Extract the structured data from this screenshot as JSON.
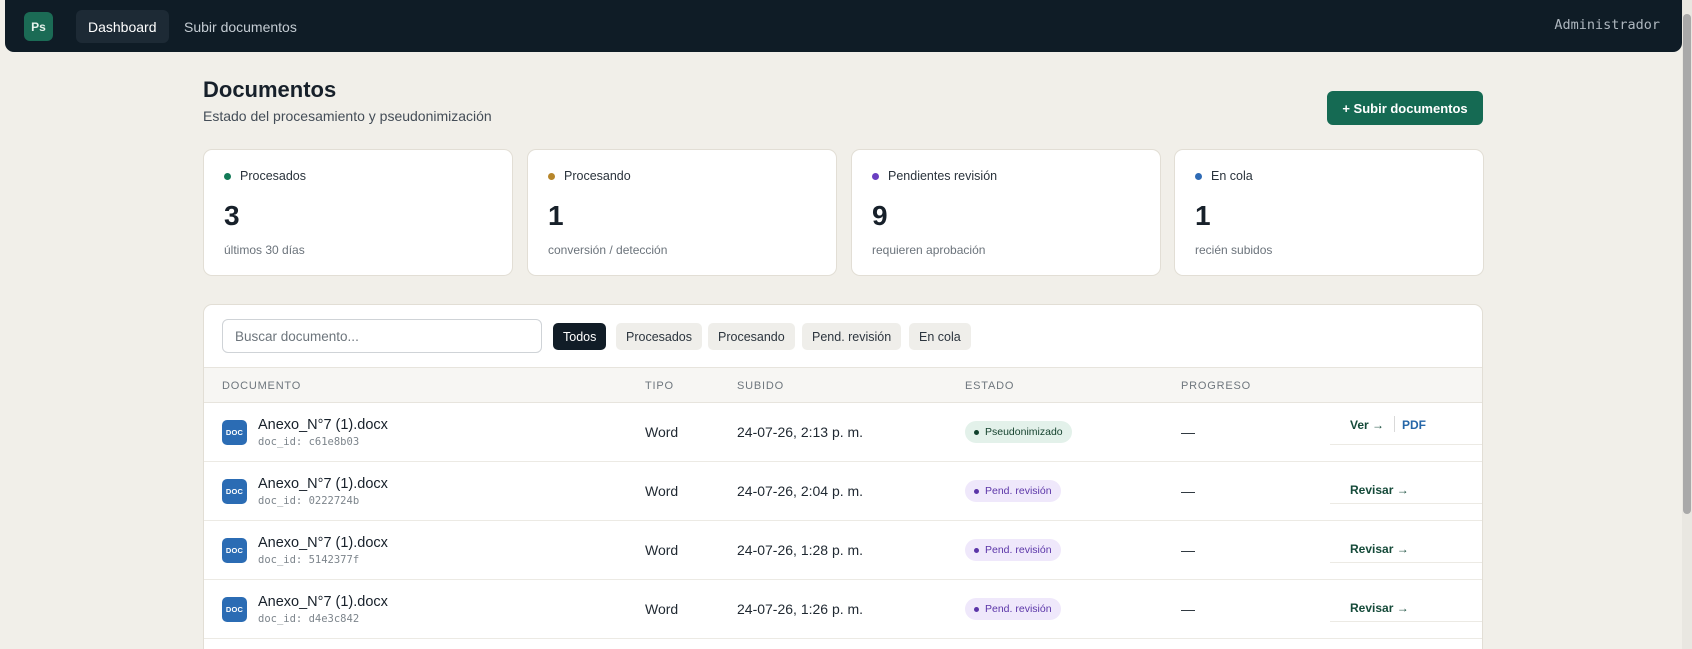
{
  "nav": {
    "logo": "Ps",
    "items": [
      "Dashboard",
      "Subir documentos"
    ],
    "user": "Administrador"
  },
  "header": {
    "title": "Documentos",
    "subtitle": "Estado del procesamiento y pseudonimización",
    "upload_button": "+ Subir documentos"
  },
  "stats": [
    {
      "label": "Procesados",
      "value": "3",
      "note": "últimos 30 días",
      "color": "#137a57"
    },
    {
      "label": "Procesando",
      "value": "1",
      "note": "conversión / detección",
      "color": "#b7862a"
    },
    {
      "label": "Pendientes revisión",
      "value": "9",
      "note": "requieren aprobación",
      "color": "#6a3fc1"
    },
    {
      "label": "En cola",
      "value": "1",
      "note": "recién subidos",
      "color": "#2f6bb5"
    }
  ],
  "search": {
    "placeholder": "Buscar documento..."
  },
  "filters": [
    "Todos",
    "Procesados",
    "Procesando",
    "Pend. revisión",
    "En cola"
  ],
  "table": {
    "columns": [
      "DOCUMENTO",
      "TIPO",
      "SUBIDO",
      "ESTADO",
      "PROGRESO"
    ],
    "rows": [
      {
        "icon_text": "DOC",
        "name": "Anexo_N°7 (1).docx",
        "doc_id": "doc_id: c61e8b03",
        "type": "Word",
        "uploaded": "24-07-26, 2:13 p. m.",
        "status": "Pseudonimizado",
        "progress": "—",
        "actions": [
          "Ver →",
          "PDF"
        ]
      },
      {
        "icon_text": "DOC",
        "name": "Anexo_N°7 (1).docx",
        "doc_id": "doc_id: 0222724b",
        "type": "Word",
        "uploaded": "24-07-26, 2:04 p. m.",
        "status": "Pend. revisión",
        "progress": "—",
        "actions": [
          "Revisar →"
        ]
      },
      {
        "icon_text": "DOC",
        "name": "Anexo_N°7 (1).docx",
        "doc_id": "doc_id: 5142377f",
        "type": "Word",
        "uploaded": "24-07-26, 1:28 p. m.",
        "status": "Pend. revisión",
        "progress": "—",
        "actions": [
          "Revisar →"
        ]
      },
      {
        "icon_text": "DOC",
        "name": "Anexo_N°7 (1).docx",
        "doc_id": "doc_id: d4e3c842",
        "type": "Word",
        "uploaded": "24-07-26, 1:26 p. m.",
        "status": "Pend. revisión",
        "progress": "—",
        "actions": [
          "Revisar →"
        ]
      }
    ]
  }
}
